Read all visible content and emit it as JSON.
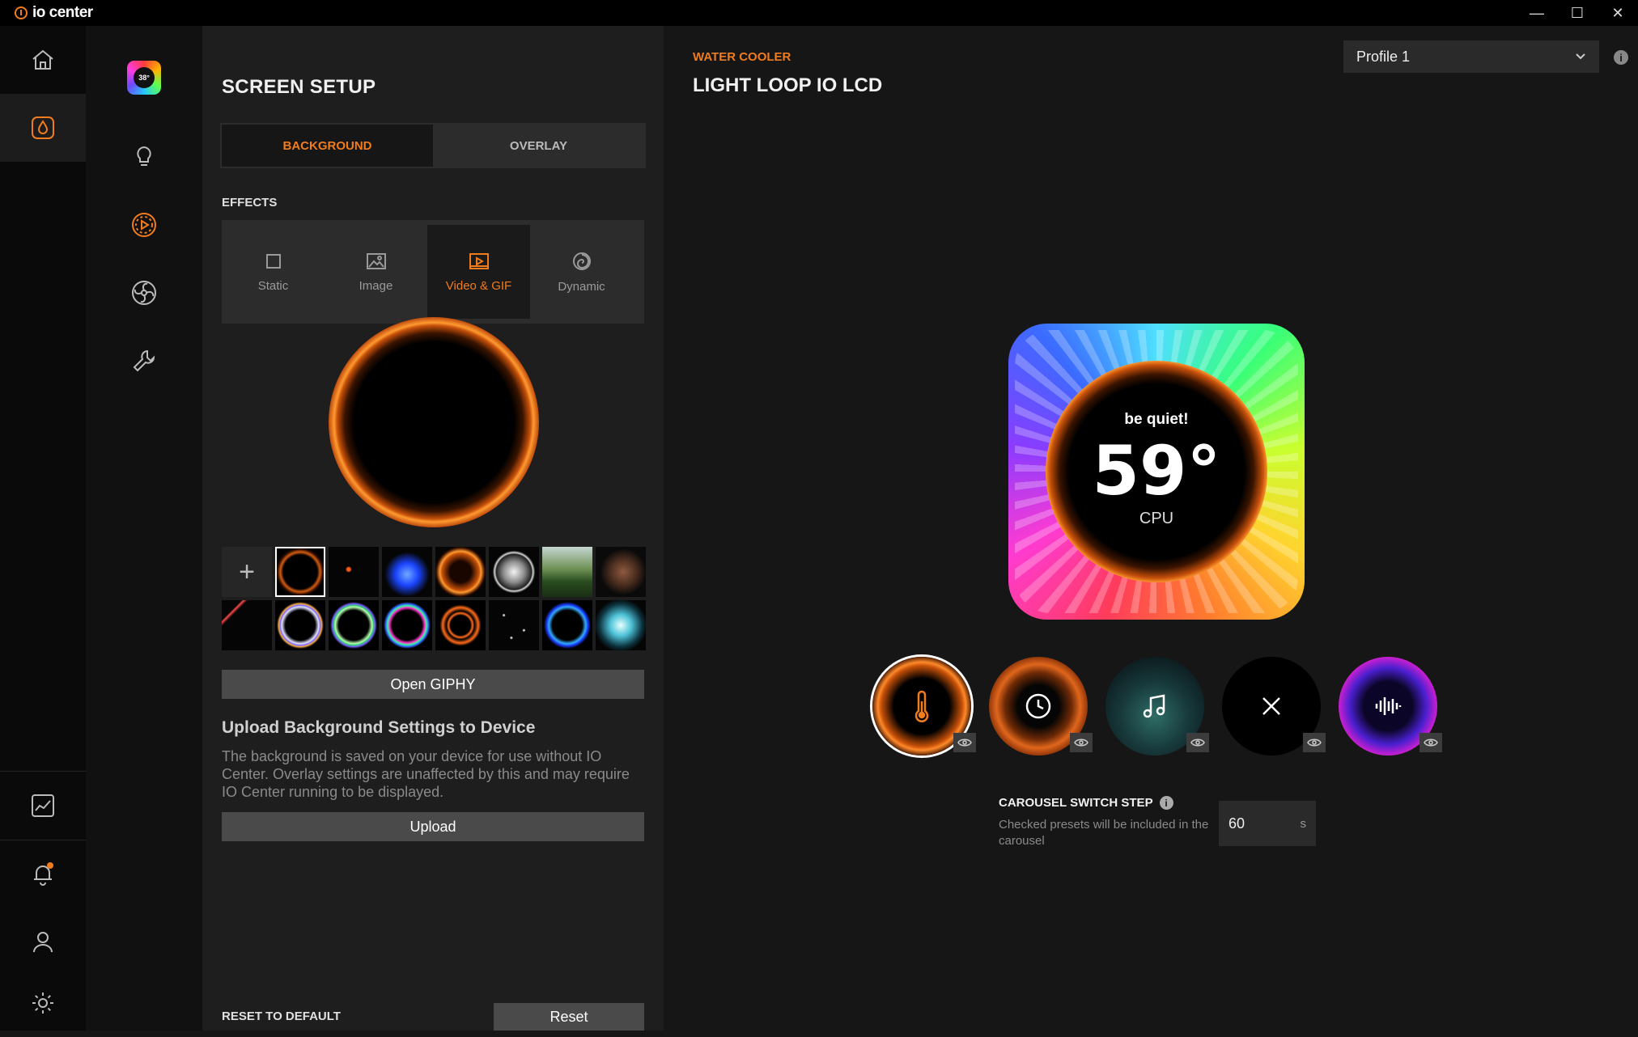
{
  "app": {
    "name": "io center",
    "colors": {
      "accent": "#f07c1d",
      "background": "#161616",
      "panel": "#1e1e1e"
    }
  },
  "window": {
    "minimize": "—",
    "maximize": "☐",
    "close": "✕"
  },
  "nav": {
    "items": [
      {
        "name": "home",
        "icon": "home-icon"
      },
      {
        "name": "water-cooler",
        "icon": "droplet-icon",
        "active": true
      },
      {
        "name": "monitoring",
        "icon": "chart-icon"
      },
      {
        "name": "notifications",
        "icon": "bell-icon",
        "badge": true
      },
      {
        "name": "account",
        "icon": "user-icon"
      },
      {
        "name": "settings",
        "icon": "gear-icon"
      }
    ]
  },
  "subnav": {
    "device_thumb_text": "38°",
    "items": [
      {
        "name": "lighting",
        "icon": "bulb-icon"
      },
      {
        "name": "screen",
        "icon": "play-circle-icon",
        "active": true
      },
      {
        "name": "fan",
        "icon": "fan-icon"
      },
      {
        "name": "tools",
        "icon": "wrench-icon"
      }
    ]
  },
  "panel": {
    "title": "SCREEN SETUP",
    "tabs": [
      {
        "label": "BACKGROUND",
        "active": true
      },
      {
        "label": "OVERLAY",
        "active": false
      }
    ],
    "effects_label": "EFFECTS",
    "effects": [
      {
        "label": "Static",
        "icon": "square-icon"
      },
      {
        "label": "Image",
        "icon": "image-icon"
      },
      {
        "label": "Video & GIF",
        "icon": "video-icon",
        "active": true
      },
      {
        "label": "Dynamic",
        "icon": "swirl-icon"
      }
    ],
    "open_giphy": "Open GIPHY",
    "upload_title": "Upload Background Settings to Device",
    "upload_desc": "The background is saved on your device for use without IO Center. Overlay settings are unaffected by this and may require IO Center running to be displayed.",
    "upload_button": "Upload",
    "reset_label": "RESET TO DEFAULT",
    "reset_button": "Reset",
    "add_symbol": "+"
  },
  "main": {
    "category": "WATER COOLER",
    "device_name": "LIGHT LOOP IO LCD",
    "profile": "Profile 1",
    "info": "i",
    "lcd": {
      "brand": "be quiet!",
      "temperature": "59°",
      "label": "CPU"
    },
    "presets": [
      {
        "name": "temperature",
        "icon": "thermometer-icon",
        "active": true
      },
      {
        "name": "clock",
        "icon": "clock-icon"
      },
      {
        "name": "music",
        "icon": "music-icon"
      },
      {
        "name": "none",
        "icon": "close-icon"
      },
      {
        "name": "audio",
        "icon": "waveform-icon"
      }
    ],
    "carousel": {
      "title": "CAROUSEL SWITCH STEP",
      "info": "i",
      "desc": "Checked presets will be included in the carousel",
      "value": "60",
      "unit": "s"
    }
  }
}
